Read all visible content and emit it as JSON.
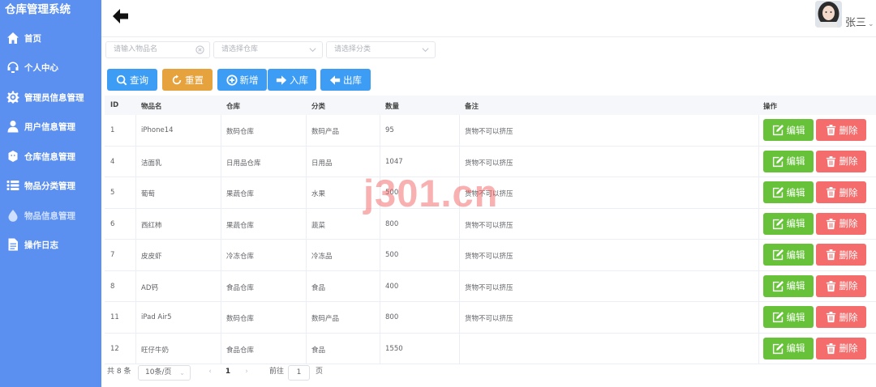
{
  "app": {
    "title": "仓库管理系统"
  },
  "sidebar": {
    "items": [
      {
        "label": "首页",
        "icon": "home-icon"
      },
      {
        "label": "个人中心",
        "icon": "headset-icon"
      },
      {
        "label": "管理员信息管理",
        "icon": "gear-icon"
      },
      {
        "label": "用户信息管理",
        "icon": "user-icon"
      },
      {
        "label": "仓库信息管理",
        "icon": "warehouse-icon"
      },
      {
        "label": "物品分类管理",
        "icon": "list-icon"
      },
      {
        "label": "物品信息管理",
        "icon": "drop-icon"
      },
      {
        "label": "操作日志",
        "icon": "document-icon"
      }
    ]
  },
  "header": {
    "username": "张三"
  },
  "filters": {
    "name_placeholder": "请输入物品名",
    "warehouse_placeholder": "请选择仓库",
    "category_placeholder": "请选择分类"
  },
  "toolbar": {
    "query": "查询",
    "reset": "重置",
    "add": "新增",
    "inbound": "入库",
    "outbound": "出库"
  },
  "table": {
    "headers": {
      "id": "ID",
      "name": "物品名",
      "warehouse": "仓库",
      "category": "分类",
      "quantity": "数量",
      "note": "备注",
      "actions": "操作"
    },
    "edit_label": "编辑",
    "delete_label": "删除",
    "rows": [
      {
        "id": "1",
        "name": "iPhone14",
        "warehouse": "数码仓库",
        "category": "数码产品",
        "quantity": "95",
        "note": "货物不可以挤压"
      },
      {
        "id": "4",
        "name": "洁面乳",
        "warehouse": "日用品仓库",
        "category": "日用品",
        "quantity": "1047",
        "note": "货物不可以挤压"
      },
      {
        "id": "5",
        "name": "葡萄",
        "warehouse": "果蔬仓库",
        "category": "水果",
        "quantity": "500",
        "note": "货物不可以挤压"
      },
      {
        "id": "6",
        "name": "西红柿",
        "warehouse": "果蔬仓库",
        "category": "蔬菜",
        "quantity": "800",
        "note": "货物不可以挤压"
      },
      {
        "id": "7",
        "name": "皮皮虾",
        "warehouse": "冷冻仓库",
        "category": "冷冻品",
        "quantity": "500",
        "note": "货物不可以挤压"
      },
      {
        "id": "8",
        "name": "AD钙",
        "warehouse": "食品仓库",
        "category": "食品",
        "quantity": "400",
        "note": "货物不可以挤压"
      },
      {
        "id": "11",
        "name": "iPad Air5",
        "warehouse": "数码仓库",
        "category": "数码产品",
        "quantity": "800",
        "note": "货物不可以挤压"
      },
      {
        "id": "12",
        "name": "旺仔牛奶",
        "warehouse": "食品仓库",
        "category": "食品",
        "quantity": "1550",
        "note": ""
      }
    ]
  },
  "pagination": {
    "total": "共 8 条",
    "page_size": "10条/页",
    "current": "1",
    "goto_prefix": "前往",
    "goto_value": "1",
    "goto_suffix": "页"
  },
  "watermark": "j301.cn"
}
